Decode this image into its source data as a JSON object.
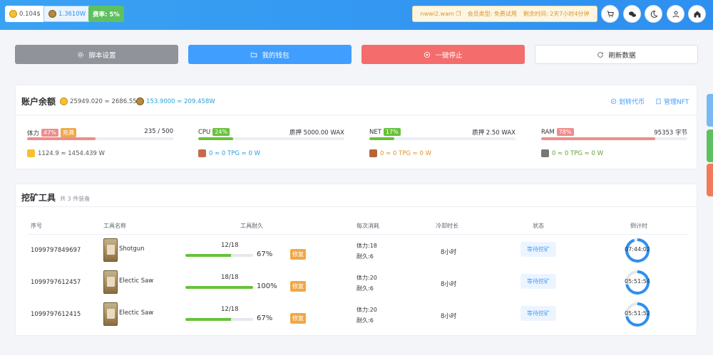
{
  "topbar": {
    "price_wax": "0.104$",
    "price_tlm": "1.3610W",
    "rate": "费率: 5%",
    "account": "nwwi2.wam",
    "member_type": "会员类型: 免费试用",
    "remaining": "剩余时间: 2天7小时4分钟",
    "icons": [
      "cart-icon",
      "wechat-icon",
      "moon-icon",
      "user-icon",
      "home-icon"
    ]
  },
  "actions": {
    "settings": "脚本设置",
    "wallet": "我的钱包",
    "stop": "一键停止",
    "refresh": "刷新数据"
  },
  "balance": {
    "title": "账户余额",
    "tlm": "25949.020 ≈ 2686.554$",
    "wax": "153.9000 ≈ 209.458W",
    "transfer": "划转代币",
    "manage_nft": "管理NFT"
  },
  "resources": [
    {
      "name": "体力",
      "tag": "47%",
      "tag2": "充满",
      "right": "235 / 500",
      "fill": 0.47,
      "color": "#f08c8c",
      "sub": "1124.9 ≈ 1454.439 W",
      "sub_color": "#555",
      "icon_color": "#f6c034"
    },
    {
      "name": "CPU",
      "tag": "24%",
      "right": "质押 5000.00 WAX",
      "fill": 0.24,
      "color": "#67c23a",
      "sub": "0 ≈ 0 TPG ≈ 0 W",
      "sub_color": "#2aa1d8",
      "icon_color": "#c9694a"
    },
    {
      "name": "NET",
      "tag": "17%",
      "right": "质押 2.50 WAX",
      "fill": 0.17,
      "color": "#67c23a",
      "sub": "0 ≈ 0 TPG ≈ 0 W",
      "sub_color": "#d9962a",
      "icon_color": "#b5653a"
    },
    {
      "name": "RAM",
      "tag": "78%",
      "right": "95353 字节",
      "fill": 0.78,
      "color": "#f08c8c",
      "sub": "0 ≈ 0 TPG ≈ 0 W",
      "sub_color": "#67a23a",
      "icon_color": "#777"
    }
  ],
  "tools": {
    "title": "挖矿工具",
    "subtitle": "共 3 件装备",
    "headers": [
      "序号",
      "工具名称",
      "工具耐久",
      "每次消耗",
      "冷却时长",
      "状态",
      "倒计时"
    ],
    "rows": [
      {
        "id": "1099797849697",
        "name": "Shotgun",
        "dur": "12/18",
        "fill": 0.67,
        "pct": "67%",
        "repair": "修复",
        "cost1": "体力:18",
        "cost2": "耐久:6",
        "cooldown": "8小时",
        "status": "等待挖矿",
        "timer": "07:44:02",
        "progress": 0.95
      },
      {
        "id": "1099797612457",
        "name": "Electic Saw",
        "dur": "18/18",
        "fill": 1.0,
        "pct": "100%",
        "repair": "修复",
        "cost1": "体力:20",
        "cost2": "耐久:6",
        "cooldown": "8小时",
        "status": "等待挖矿",
        "timer": "05:51:54",
        "progress": 0.72
      },
      {
        "id": "1099797612415",
        "name": "Electic Saw",
        "dur": "12/18",
        "fill": 0.67,
        "pct": "67%",
        "repair": "修复",
        "cost1": "体力:20",
        "cost2": "耐久:6",
        "cooldown": "8小时",
        "status": "等待挖矿",
        "timer": "05:51:52",
        "progress": 0.72
      }
    ]
  },
  "colors": {
    "primary": "#409eff",
    "danger": "#f56c6c",
    "success": "#67c23a",
    "warning": "#f0a84a",
    "side_tabs": [
      "#79b8f3",
      "#5fc05f",
      "#f07a5a"
    ]
  }
}
